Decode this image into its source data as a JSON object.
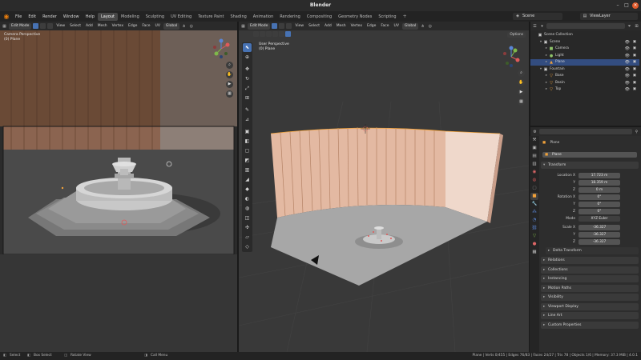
{
  "window": {
    "title": "Blender",
    "minimize": "–",
    "maximize": "□",
    "close": "×"
  },
  "menu": {
    "items": [
      "File",
      "Edit",
      "Render",
      "Window",
      "Help"
    ],
    "workspaces": [
      "Layout",
      "Modeling",
      "Sculpting",
      "UV Editing",
      "Texture Paint",
      "Shading",
      "Animation",
      "Rendering",
      "Compositing",
      "Geometry Nodes",
      "Scripting"
    ],
    "active_workspace": "Layout",
    "add_workspace": "+",
    "scene": "Scene",
    "view_layer": "ViewLayer"
  },
  "left_viewport": {
    "mode": "Edit Mode",
    "menus": [
      "View",
      "Select",
      "Add",
      "Mesh",
      "Vertex",
      "Edge",
      "Face",
      "UV"
    ],
    "orientation": "Global",
    "perspective_label": "Camera Perspective",
    "object_label": "(0) Plane"
  },
  "right_viewport": {
    "mode": "Edit Mode",
    "menus": [
      "View",
      "Select",
      "Add",
      "Mesh",
      "Vertex",
      "Edge",
      "Face",
      "UV"
    ],
    "orientation": "Global",
    "options": "Options",
    "perspective_label": "User Perspective",
    "object_label": "(0) Plane"
  },
  "outliner": {
    "title": "Scene Collection",
    "rows": [
      {
        "name": "Scene Collection",
        "indent": 0,
        "icon": "▣",
        "color": "#d8d8d8",
        "selected": false,
        "twisty": ""
      },
      {
        "name": "Scene",
        "indent": 1,
        "icon": "▣",
        "color": "#d8d8d8",
        "selected": false,
        "twisty": "▾"
      },
      {
        "name": "Camera",
        "indent": 2,
        "icon": "■",
        "color": "#8fc46a",
        "selected": false,
        "twisty": "▸"
      },
      {
        "name": "Light",
        "indent": 2,
        "icon": "●",
        "color": "#8fc46a",
        "selected": false,
        "twisty": "▸"
      },
      {
        "name": "Plane",
        "indent": 2,
        "icon": "▲",
        "color": "#f0a13a",
        "selected": true,
        "twisty": "▸"
      },
      {
        "name": "Fountain",
        "indent": 1,
        "icon": "▣",
        "color": "#d8d8d8",
        "selected": false,
        "twisty": "▾"
      },
      {
        "name": "Base",
        "indent": 2,
        "icon": "▽",
        "color": "#f0a13a",
        "selected": false,
        "twisty": "▸"
      },
      {
        "name": "Basin",
        "indent": 2,
        "icon": "▽",
        "color": "#f0a13a",
        "selected": false,
        "twisty": "▸"
      },
      {
        "name": "Top",
        "indent": 2,
        "icon": "▽",
        "color": "#f0a13a",
        "selected": false,
        "twisty": "▸"
      }
    ]
  },
  "properties": {
    "object_name": "Plane",
    "data_name": "Plane",
    "transform_label": "Transform",
    "location_label": "Location X",
    "location": [
      "17.723 m",
      "18.359 m",
      "0 m"
    ],
    "rotation_label": "Rotation X",
    "rotation": [
      "0°",
      "0°",
      "0°"
    ],
    "mode_label": "Mode",
    "mode": "XYZ Euler",
    "scale_label": "Scale X",
    "scale": [
      "-36.327",
      "-36.327",
      "-36.327"
    ],
    "axis_y": "Y",
    "axis_z": "Z",
    "delta_label": "Delta Transform",
    "sections": [
      "Relations",
      "Collections",
      "Instancing",
      "Motion Paths",
      "Visibility",
      "Viewport Display",
      "Line Art",
      "Custom Properties"
    ]
  },
  "status": {
    "select": "Select",
    "box_select": "Box Select",
    "rotate_view": "Rotate View",
    "call_menu": "Call Menu",
    "stats": "Plane | Verts 0/455 | Edges 76/83 | Faces 24/27 | Tris 78 | Objects 1/6 | Memory: 37.3 MiB | 4.0.1"
  },
  "colors": {
    "accent": "#4772b3",
    "selection": "#334d80",
    "wall_peach": "#e8c2ad",
    "wall_stripe": "#b07a5e",
    "floor": "#a7a7a7",
    "orange_vertex": "#f0a13a"
  }
}
